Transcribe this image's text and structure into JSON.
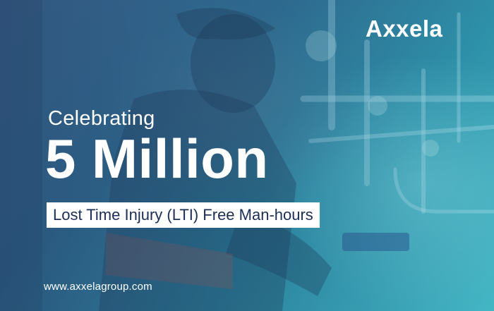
{
  "brand": {
    "logo_text": "Axxela"
  },
  "banner": {
    "kicker": "Celebrating",
    "headline": "5 Million",
    "subline": "Lost Time Injury (LTI) Free Man-hours",
    "website": "www.axxelagroup.com"
  },
  "colors": {
    "background_dark": "#2c5f86",
    "background_light": "#45b9c6",
    "text": "#ffffff",
    "subline_box": "#ffffff",
    "subline_text": "#1d2f55"
  }
}
